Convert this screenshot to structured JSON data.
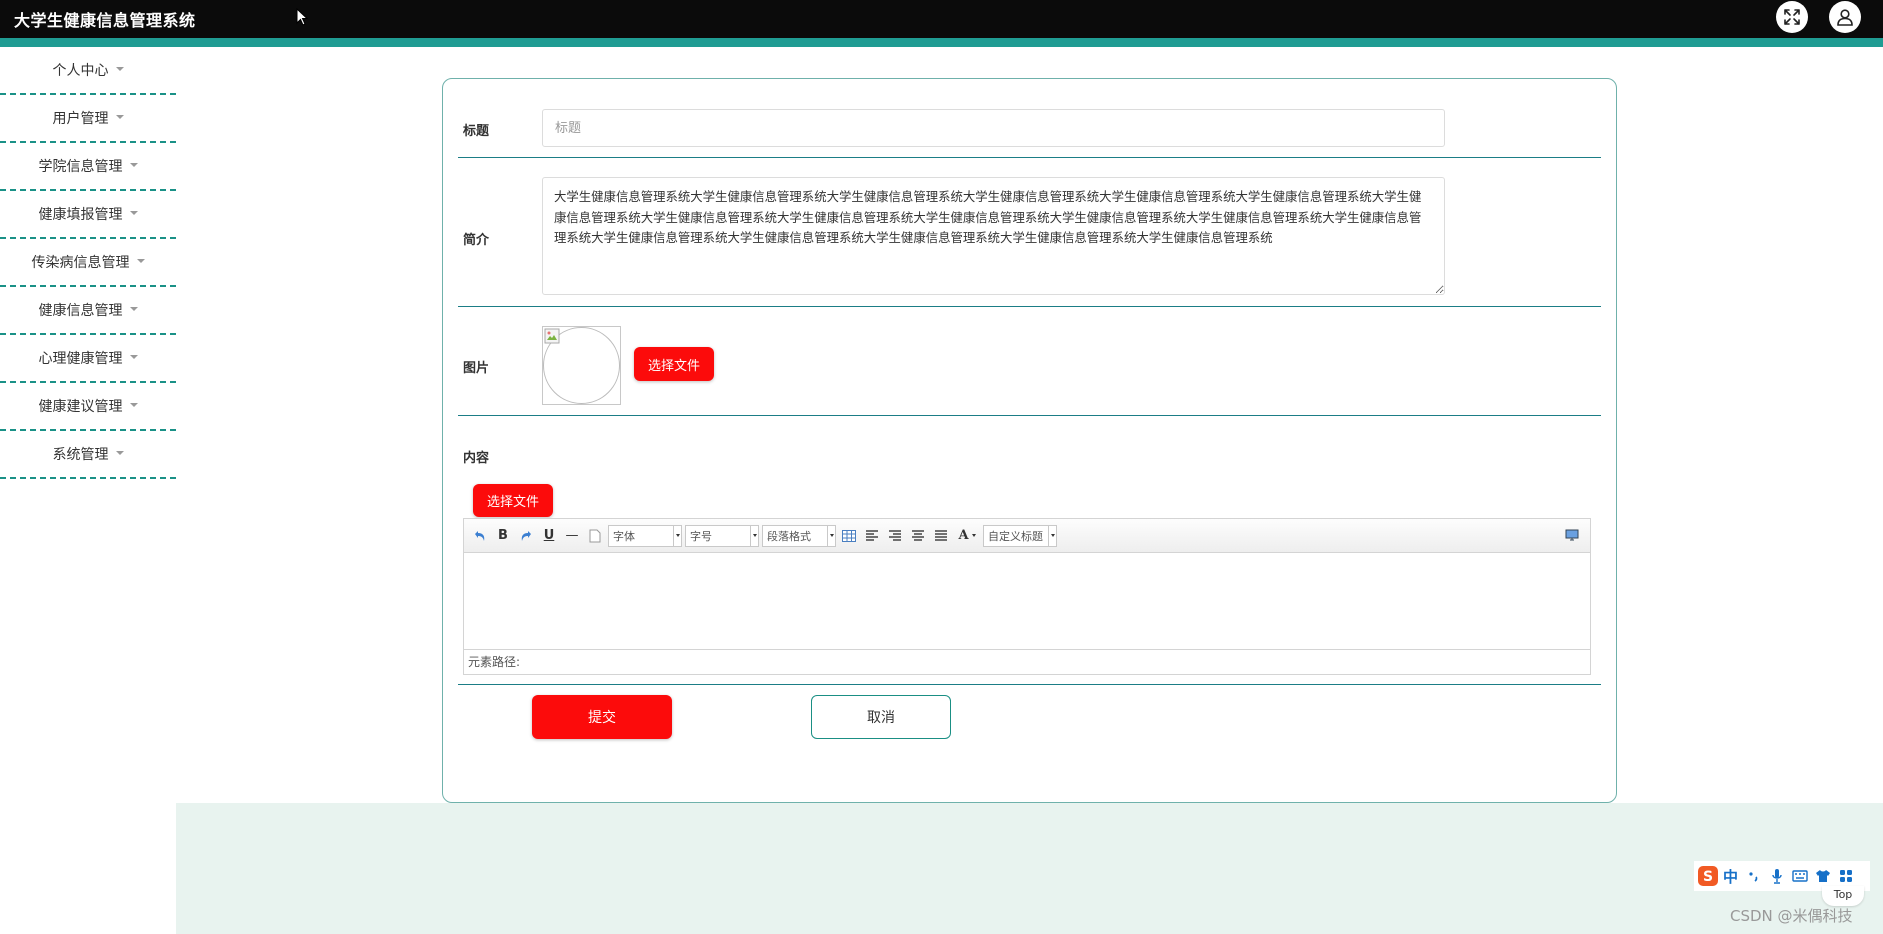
{
  "header": {
    "title": "大学生健康信息管理系统",
    "icons": [
      "fullscreen-icon",
      "user-icon"
    ]
  },
  "sidebar": {
    "items": [
      {
        "label": "个人中心"
      },
      {
        "label": "用户管理"
      },
      {
        "label": "学院信息管理"
      },
      {
        "label": "健康填报管理"
      },
      {
        "label": "传染病信息管理"
      },
      {
        "label": "健康信息管理"
      },
      {
        "label": "心理健康管理"
      },
      {
        "label": "健康建议管理"
      },
      {
        "label": "系统管理"
      }
    ]
  },
  "form": {
    "title_label": "标题",
    "title_placeholder": "标题",
    "title_value": "",
    "intro_label": "简介",
    "intro_value": "大学生健康信息管理系统大学生健康信息管理系统大学生健康信息管理系统大学生健康信息管理系统大学生健康信息管理系统大学生健康信息管理系统大学生健康信息管理系统大学生健康信息管理系统大学生健康信息管理系统大学生健康信息管理系统大学生健康信息管理系统大学生健康信息管理系统大学生健康信息管理系统大学生健康信息管理系统大学生健康信息管理系统大学生健康信息管理系统大学生健康信息管理系统大学生健康信息管理系统",
    "image_label": "图片",
    "image_upload_label": "选择文件",
    "content_label": "内容",
    "content_upload_label": "选择文件",
    "submit_label": "提交",
    "cancel_label": "取消"
  },
  "editor": {
    "font_family": "字体",
    "font_size": "字号",
    "paragraph": "段落格式",
    "custom_title": "自定义标题",
    "bold_glyph": "B",
    "underline_glyph": "U",
    "hr_glyph": "—",
    "font_color_glyph": "A",
    "status_label": "元素路径:"
  },
  "ime": {
    "lang": "中",
    "top_label": "Top"
  },
  "watermark": "CSDN @米偶科技",
  "colors": {
    "topbar": "#0b0b0b",
    "accent": "#1f9c93",
    "primary_button": "#fc0b0b",
    "content_bg": "#e8f3ef"
  }
}
